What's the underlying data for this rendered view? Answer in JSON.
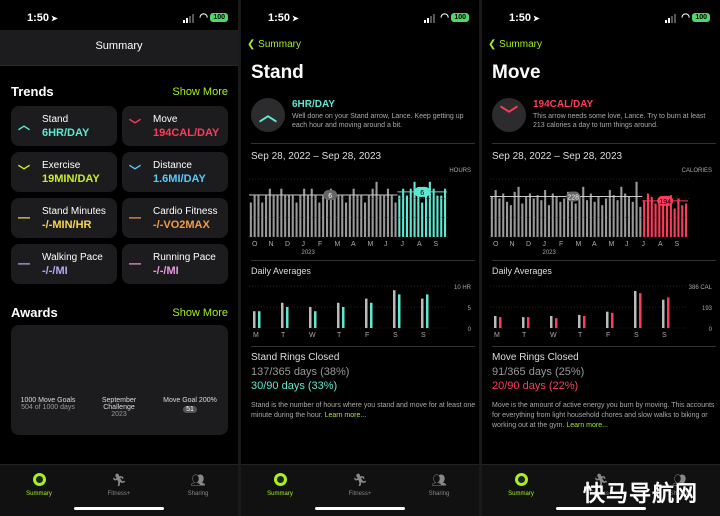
{
  "status": {
    "time": "1:50",
    "battery": "100"
  },
  "summary": {
    "title": "Summary",
    "trends_title": "Trends",
    "show_more": "Show More",
    "tiles": [
      {
        "name": "Stand",
        "value": "6HR/DAY",
        "color": "#5ee7d2",
        "icon": "up-chevron-icon"
      },
      {
        "name": "Move",
        "value": "194CAL/DAY",
        "color": "#ff3b5c",
        "icon": "down-chevron-icon"
      },
      {
        "name": "Exercise",
        "value": "19MIN/DAY",
        "color": "#c4f027",
        "icon": "down-chevron-icon"
      },
      {
        "name": "Distance",
        "value": "1.6MI/DAY",
        "color": "#5ac8fa",
        "icon": "down-chevron-icon"
      },
      {
        "name": "Stand Minutes",
        "value": "-/-MIN/HR",
        "color": "#f5d74a",
        "icon": "dash-icon"
      },
      {
        "name": "Cardio Fitness",
        "value": "-/-VO2MAX",
        "color": "#f39c45",
        "icon": "dash-icon"
      },
      {
        "name": "Walking Pace",
        "value": "-/-/MI",
        "color": "#b6a7f5",
        "icon": "dash-icon"
      },
      {
        "name": "Running Pace",
        "value": "-/-/MI",
        "color": "#e79ae0",
        "icon": "dash-icon"
      }
    ],
    "awards_title": "Awards",
    "awards": [
      {
        "title": "1000 Move Goals",
        "sub": "504 of 1000 days"
      },
      {
        "title": "September Challenge",
        "sub": "2023"
      },
      {
        "title": "Move Goal 200%",
        "sub": "51"
      }
    ]
  },
  "tabs": [
    {
      "label": "Summary",
      "icon": "activity-ring-icon"
    },
    {
      "label": "Fitness+",
      "icon": "fitness-plus-icon"
    },
    {
      "label": "Sharing",
      "icon": "sharing-icon"
    }
  ],
  "stand": {
    "back": "Summary",
    "title": "Stand",
    "value": "6HR/DAY",
    "desc": "Well done on your Stand arrow, Lance. Keep getting up each hour and moving around a bit.",
    "range": "Sep 28, 2022 – Sep 28, 2023",
    "axis_caption": "HOURS",
    "daily_title": "Daily Averages",
    "closed_title": "Stand Rings Closed",
    "closed_year": "137/365 days (38%)",
    "closed_recent": "30/90 days (33%)",
    "footer": "Stand is the number of hours where you stand and move for at least one minute during the hour.",
    "learn_more": "Learn more...",
    "color": "#5ee7d2"
  },
  "move": {
    "back": "Summary",
    "title": "Move",
    "value": "194CAL/DAY",
    "desc": "This arrow needs some love, Lance. Try to burn at least 213 calories a day to turn things around.",
    "range": "Sep 28, 2022 – Sep 28, 2023",
    "axis_caption": "CALORIES",
    "daily_title": "Daily Averages",
    "closed_title": "Move Rings Closed",
    "closed_year": "91/365 days (25%)",
    "closed_recent": "20/90 days (22%)",
    "footer": "Move is the amount of active energy you burn by moving. This accounts for everything from light household chores and slow walks to biking or working out at the gym.",
    "learn_more": "Learn more...",
    "color": "#ff3b5c"
  },
  "watermark": "快马导航网",
  "chart_data": [
    {
      "type": "bar",
      "title": "Stand yearly",
      "categories": [
        "O",
        "N",
        "D",
        "J",
        "F",
        "M",
        "A",
        "M",
        "J",
        "J",
        "A",
        "S"
      ],
      "extra_label": "2023",
      "values": [
        5,
        6,
        6,
        5,
        6,
        7,
        6,
        6,
        7,
        6,
        6,
        6,
        5,
        6,
        7,
        6,
        7,
        6,
        5,
        6,
        6,
        7,
        6,
        6,
        6,
        5,
        6,
        7,
        6,
        6,
        5,
        6,
        7,
        8,
        6,
        6,
        7,
        6,
        5,
        6,
        7,
        6,
        7,
        8,
        6,
        5,
        6,
        8,
        7,
        6,
        6,
        7
      ],
      "highlight_from": 39,
      "average_label": "6",
      "yticks": []
    },
    {
      "type": "bar",
      "title": "Stand daily averages",
      "categories": [
        "M",
        "T",
        "W",
        "T",
        "F",
        "S",
        "S"
      ],
      "series": [
        {
          "values": [
            4,
            6,
            5,
            6,
            7,
            9,
            7
          ]
        },
        {
          "values": [
            4,
            5,
            4,
            5,
            6,
            8,
            8
          ]
        }
      ],
      "yticks": [
        "10 HR",
        "5",
        "0"
      ],
      "ylim": [
        0,
        10
      ]
    },
    {
      "type": "bar",
      "title": "Move yearly",
      "categories": [
        "O",
        "N",
        "D",
        "J",
        "F",
        "M",
        "A",
        "M",
        "J",
        "J",
        "A",
        "S"
      ],
      "extra_label": "2023",
      "values": [
        240,
        280,
        230,
        260,
        210,
        190,
        270,
        300,
        200,
        240,
        260,
        230,
        250,
        220,
        280,
        190,
        260,
        240,
        210,
        230,
        270,
        250,
        200,
        240,
        300,
        220,
        260,
        210,
        240,
        190,
        230,
        280,
        250,
        220,
        300,
        260,
        240,
        210,
        330,
        180,
        220,
        260,
        240,
        200,
        230,
        190,
        210,
        250,
        170,
        230,
        190,
        200
      ],
      "highlight_from": 40,
      "average_label": "228",
      "average_label_recent": "194",
      "yticks": []
    },
    {
      "type": "bar",
      "title": "Move daily averages",
      "categories": [
        "M",
        "T",
        "W",
        "T",
        "F",
        "S",
        "S"
      ],
      "series": [
        {
          "values": [
            110,
            100,
            110,
            120,
            150,
            340,
            260
          ]
        },
        {
          "values": [
            100,
            100,
            90,
            110,
            140,
            320,
            280
          ]
        }
      ],
      "yticks": [
        "386 CAL",
        "193",
        "0"
      ],
      "ylim": [
        0,
        386
      ]
    }
  ]
}
